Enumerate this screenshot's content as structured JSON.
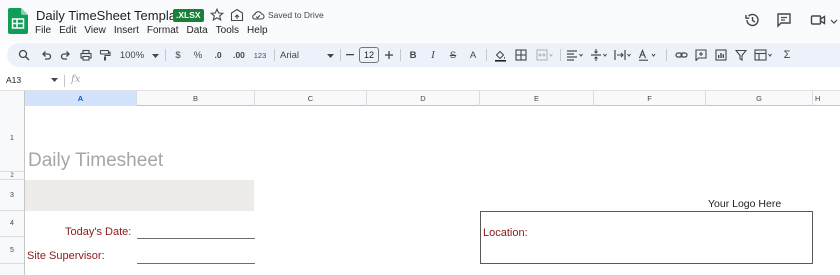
{
  "document": {
    "title": "Daily TimeSheet Template",
    "file_badge": ".XLSX",
    "save_status": "Saved to Drive"
  },
  "menu": [
    "File",
    "Edit",
    "View",
    "Insert",
    "Format",
    "Data",
    "Tools",
    "Help"
  ],
  "toolbar": {
    "zoom": "100%",
    "currency": "$",
    "percent": "%",
    "decrease_decimal": ".0",
    "increase_decimal": ".00",
    "more_formats": "123",
    "font": "Arial",
    "font_size": "12",
    "bold": "B",
    "italic": "I",
    "strikethrough": "S",
    "text_color": "A",
    "functions": "Σ"
  },
  "formula_bar": {
    "cell_ref": "A13",
    "fx": "fx",
    "content": ""
  },
  "grid": {
    "columns": [
      "A",
      "B",
      "C",
      "D",
      "E",
      "F",
      "G",
      "H"
    ],
    "selected_column": "A",
    "rows": [
      "1",
      "2",
      "3",
      "4",
      "5"
    ]
  },
  "sheet": {
    "title": "Daily Timesheet",
    "todays_date_label": "Today's Date:",
    "site_supervisor_label": "Site Supervisor:",
    "location_label": "Location:",
    "logo_placeholder": "Your Logo Here"
  },
  "colors": {
    "brand_green": "#188038",
    "label_red": "#8b1a1a",
    "title_gray": "#a6a6a6",
    "band_gray": "#eeece8",
    "selected_header": "#d3e3fd"
  }
}
